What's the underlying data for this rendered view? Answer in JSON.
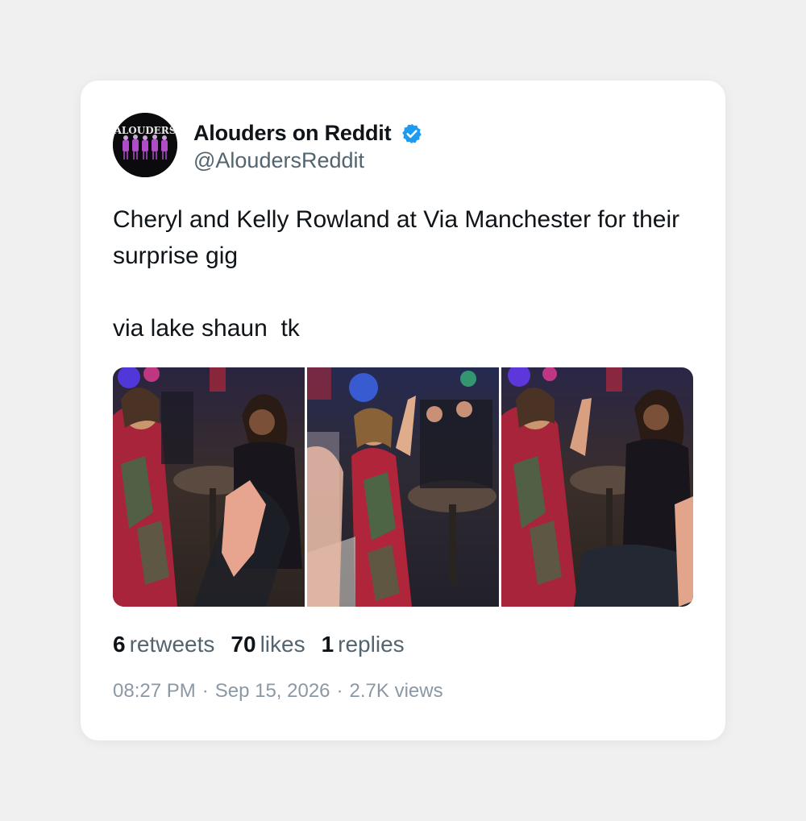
{
  "author": {
    "display_name": "Alouders on Reddit",
    "handle": "@AloudersReddit",
    "verified": true,
    "avatar_text": "ALOUDERS",
    "verified_color": "#1d9bf0"
  },
  "tweet": {
    "text": "Cheryl and Kelly Rowland at Via Manchester for their surprise gig\n\nvia lake shaun  tk"
  },
  "media": [
    {
      "name": "photo-1"
    },
    {
      "name": "photo-2"
    },
    {
      "name": "photo-3"
    }
  ],
  "stats": {
    "retweets_count": "6",
    "retweets_label": "retweets",
    "likes_count": "70",
    "likes_label": "likes",
    "replies_count": "1",
    "replies_label": "replies"
  },
  "meta": {
    "time": "08:27 PM",
    "date": "Sep 15, 2026",
    "views": "2.7K views",
    "separator": "·"
  }
}
